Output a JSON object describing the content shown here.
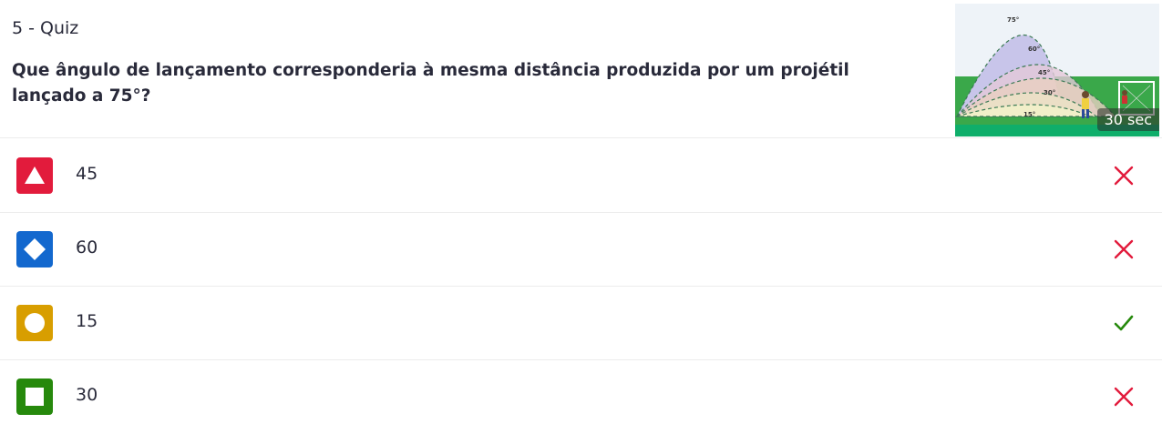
{
  "quiz": {
    "label": "5 - Quiz",
    "question": "Que ângulo de lançamento corresponderia à mesma distância produzida por um projétil lançado a 75°?",
    "timer": "30 sec",
    "image": {
      "angle_labels": [
        "75°",
        "60°",
        "45°",
        "30°",
        "15°"
      ]
    }
  },
  "answers": [
    {
      "text": "45",
      "shape": "triangle-icon",
      "color": "#e21b3c",
      "correct": false
    },
    {
      "text": "60",
      "shape": "diamond-icon",
      "color": "#1368ce",
      "correct": false
    },
    {
      "text": "15",
      "shape": "circle-icon",
      "color": "#d89e00",
      "correct": true
    },
    {
      "text": "30",
      "shape": "square-icon",
      "color": "#26890c",
      "correct": false
    }
  ],
  "colors": {
    "wrong": "#e21b3c",
    "correct": "#26890c"
  }
}
